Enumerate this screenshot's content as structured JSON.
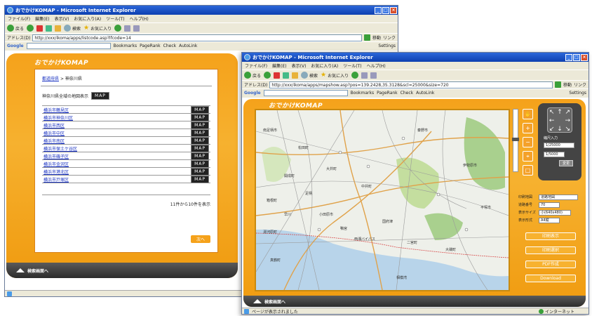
{
  "win1": {
    "title": "おでかけKOMAP - Microsoft Internet Explorer",
    "menu": [
      "ファイル(F)",
      "編集(E)",
      "表示(V)",
      "お気に入り(A)",
      "ツール(T)",
      "ヘルプ(H)"
    ],
    "toolbar": {
      "back": "戻る",
      "search": "検索",
      "favorites": "お気に入り"
    },
    "address_label": "アドレス(D)",
    "address": "http://xxx/ikoma/apps/listcode.asp?lfcode=14",
    "go": "移動",
    "links": "リンク",
    "google": {
      "logo": "Google",
      "bookmarks": "Bookmarks",
      "pagerank": "PageRank",
      "check": "Check",
      "autolink": "AutoLink",
      "settings": "Settings"
    },
    "app_logo": "おでかけKOMAP",
    "breadcrumb_home": "都道府県",
    "breadcrumb_current": "神奈川県",
    "heading": "神奈川県全域の地図表示",
    "map_label": "MAP",
    "cities": [
      "横浜市鶴見区",
      "横浜市神奈川区",
      "横浜市西区",
      "横浜市中区",
      "横浜市南区",
      "横浜市保土ケ谷区",
      "横浜市磯子区",
      "横浜市金沢区",
      "横浜市港北区",
      "横浜市戸塚区"
    ],
    "count_text": "11件から10件を表示",
    "next": "次へ",
    "footer": "検索画面へ",
    "status_left": "",
    "status_right": ""
  },
  "win2": {
    "title": "おでかけKOMAP - Microsoft Internet Explorer",
    "menu": [
      "ファイル(F)",
      "編集(E)",
      "表示(V)",
      "お気に入り(A)",
      "ツール(T)",
      "ヘルプ(H)"
    ],
    "toolbar": {
      "back": "戻る",
      "search": "検索",
      "favorites": "お気に入り"
    },
    "address_label": "アドレス(D)",
    "address": "http://xxx/ikoma/apps/mapshow.asp?pos=139.2428,35.3128&scl=25000&size=720",
    "go": "移動",
    "links": "リンク",
    "google": {
      "logo": "Google",
      "bookmarks": "Bookmarks",
      "pagerank": "PageRank",
      "check": "Check",
      "autolink": "AutoLink",
      "settings": "Settings"
    },
    "app_logo": "おでかけKOMAP",
    "scale_label": "縮尺入力",
    "scale_value": "1/25000",
    "scale_input": "1/5000",
    "scale_btn": "変更",
    "form": [
      {
        "label": "印刷地図",
        "value": "道路地図"
      },
      {
        "label": "道路番号",
        "value": "70"
      },
      {
        "label": "表示サイズ",
        "value": "小(640x480)"
      },
      {
        "label": "表示形式",
        "value": "A4縦"
      }
    ],
    "buttons": [
      "印刷表示",
      "印刷選択",
      "PDF作成",
      "Download"
    ],
    "footer": "検索画面へ",
    "status_text": "ページが表示されました",
    "status_right": "インターネット",
    "map_labels": [
      "秦野市",
      "平塚市",
      "伊勢原市",
      "大磯町",
      "小田原市",
      "二宮町",
      "中井町",
      "大井町",
      "松田町",
      "開成町",
      "南足柄市",
      "箱根町",
      "真鶴町",
      "湯河原町",
      "相模湾",
      "西湘バイパス",
      "国府津",
      "鴨宮",
      "足柄",
      "早川"
    ]
  },
  "colors": {
    "orange": "#f5a21b",
    "frame": "#c98a10",
    "titlebar": "#0d3fb0"
  }
}
